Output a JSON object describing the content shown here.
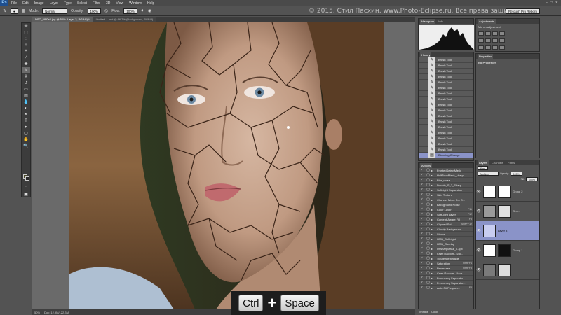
{
  "menu": {
    "logo": "Ps",
    "items": [
      "File",
      "Edit",
      "Image",
      "Layer",
      "Type",
      "Select",
      "Filter",
      "3D",
      "View",
      "Window",
      "Help"
    ]
  },
  "options": {
    "mode_label": "Mode:",
    "mode_value": "Normal",
    "opacity_label": "Opacity:",
    "opacity_value": "100%",
    "flow_label": "Flow:",
    "flow_value": "100%",
    "workspace": "Retouch Pro Reborn"
  },
  "watermark": "© 2015, Стил Пасхин, www.Photo-Eclipse.ru. Все права защищены.",
  "tabs": [
    {
      "label": "DSC_58f0e2.jpg @ 50% (Layer 3, RGB/8) *",
      "active": true
    },
    {
      "label": "Untitled-1.psd @ 66.7% (Background, RGB/8)",
      "active": false
    }
  ],
  "status": {
    "zoom": "50%",
    "doc": "Doc: 12.9M/122.3M"
  },
  "keys": {
    "ctrl": "Ctrl",
    "plus": "+",
    "space": "Space"
  },
  "histogram": {
    "tabs": [
      "Histogram",
      "Info"
    ]
  },
  "history": {
    "tabs": [
      "History"
    ],
    "items": [
      "Brush Tool",
      "Brush Tool",
      "Brush Tool",
      "Brush Tool",
      "Brush Tool",
      "Brush Tool",
      "Brush Tool",
      "Brush Tool",
      "Brush Tool",
      "Brush Tool",
      "Brush Tool",
      "Brush Tool",
      "Brush Tool",
      "Brush Tool",
      "Brush Tool",
      "Brush Tool",
      "Brush Tool"
    ],
    "selected": "Blending Change"
  },
  "actions": {
    "tabs": [
      "Actions"
    ],
    "items": [
      {
        "label": "FrostedSelectMask",
        "key": ""
      },
      {
        "label": "HalfToneBlack_sharp",
        "key": ""
      },
      {
        "label": "Blur_noise",
        "key": ""
      },
      {
        "label": "Double_S_2_Sharp",
        "key": ""
      },
      {
        "label": "SoftLight Separation",
        "key": ""
      },
      {
        "label": "Skin Texture",
        "key": ""
      },
      {
        "label": "Channel Mixer For S...",
        "key": ""
      },
      {
        "label": "Background Noise",
        "key": ""
      },
      {
        "label": "Color Layer",
        "key": "F11"
      },
      {
        "label": "SoftLight Layer",
        "key": "F12"
      },
      {
        "label": "Content-Aware Fill",
        "key": "F5"
      },
      {
        "label": "Clipped Sol...",
        "key": "Shift+F12"
      },
      {
        "label": "Cloudy Background",
        "key": ""
      },
      {
        "label": "Stroke",
        "key": ""
      },
      {
        "label": "HMB_SoftLight",
        "key": ""
      },
      {
        "label": "HMB_Overlay",
        "key": ""
      },
      {
        "label": "UnsharpMask_0.3px",
        "key": ""
      },
      {
        "label": "Стил Пасхин - Бэк...",
        "key": ""
      },
      {
        "label": "Усиление бликов",
        "key": ""
      },
      {
        "label": "Saturation",
        "key": "Shift+F4"
      },
      {
        "label": "Размытие...",
        "key": "Shift+F3"
      },
      {
        "label": "Стил Пасхин - Част...",
        "key": ""
      },
      {
        "label": "Frequency Separatio...",
        "key": ""
      },
      {
        "label": "Frequency Separatio...",
        "key": ""
      },
      {
        "label": "Auto-Fit Frequen...",
        "key": "F8"
      }
    ]
  },
  "adjustments": {
    "tabs": [
      "Adjustments"
    ],
    "title": "Add an adjustment"
  },
  "properties": {
    "tabs": [
      "Properties"
    ],
    "text": "No Properties"
  },
  "layers": {
    "tabs": [
      "Layers",
      "Channels",
      "Paths"
    ],
    "filter": "Kind",
    "blend": "Multiply",
    "opacity_label": "Opacity:",
    "opacity_value": "100%",
    "fill_label": "Fill:",
    "fill_value": "100%",
    "items": [
      {
        "name": "Group 2",
        "selected": false
      },
      {
        "name": "Gro...",
        "selected": false
      },
      {
        "name": "Layer 3",
        "selected": true
      },
      {
        "name": "Group 1",
        "selected": false
      },
      {
        "name": "",
        "selected": false
      }
    ]
  },
  "bottom_tabs": [
    "Timeline",
    "Color"
  ]
}
